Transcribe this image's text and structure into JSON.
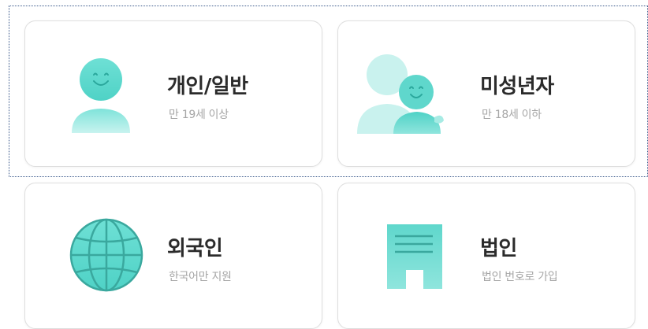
{
  "cards": [
    {
      "title": "개인/일반",
      "subtitle": "만 19세 이상",
      "icon": "person-icon"
    },
    {
      "title": "미성년자",
      "subtitle": "만 18세 이하",
      "icon": "parent-child-icon"
    },
    {
      "title": "외국인",
      "subtitle": "한국어만 지원",
      "icon": "globe-icon"
    },
    {
      "title": "법인",
      "subtitle": "법인 번호로 가입",
      "icon": "building-icon"
    }
  ],
  "colors": {
    "accent": "#5fd9cf",
    "accent_light": "#c6f1ee",
    "accent_dark": "#3fb8ad",
    "title": "#2b2b2b",
    "subtitle": "#a6a6a6",
    "border": "#dedede"
  }
}
